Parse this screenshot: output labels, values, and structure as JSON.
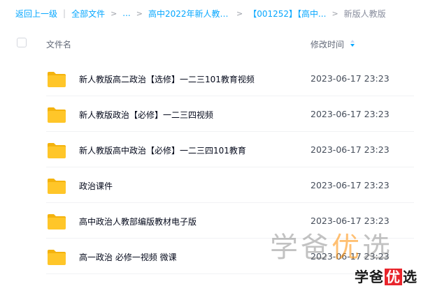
{
  "breadcrumb": {
    "back": "返回上一级",
    "items": [
      "全部文件",
      "...",
      "高中2022年新人教版...",
      "【001252】【高中...",
      "新版人教版"
    ]
  },
  "header": {
    "col_name": "文件名",
    "col_time": "修改时间"
  },
  "rows": [
    {
      "name": "新人教版高二政治【选修】一二三101教育视频",
      "time": "2023-06-17 23:23"
    },
    {
      "name": "新人教版政治【必修】一二三四视频",
      "time": "2023-06-17 23:23"
    },
    {
      "name": "新人教版高中政治【必修】一二三四101教育",
      "time": "2023-06-17 23:23"
    },
    {
      "name": "政治课件",
      "time": "2023-06-17 23:23"
    },
    {
      "name": "高中政治人教部编版教材电子版",
      "time": "2023-06-17 23:23"
    },
    {
      "name": "高一政治 必修一视频 微课",
      "time": "2023-06-17 23:23"
    }
  ],
  "watermark": {
    "big_a": "学爸",
    "big_b": "优",
    "big_c": "选",
    "small_a": "学爸",
    "small_b": "优",
    "small_c": "选"
  },
  "colors": {
    "link": "#06a7ff",
    "folder": "#ffc629",
    "folder_dark": "#f4b30e"
  },
  "icons": [
    "folder-icon",
    "sort-icon",
    "checkbox"
  ]
}
